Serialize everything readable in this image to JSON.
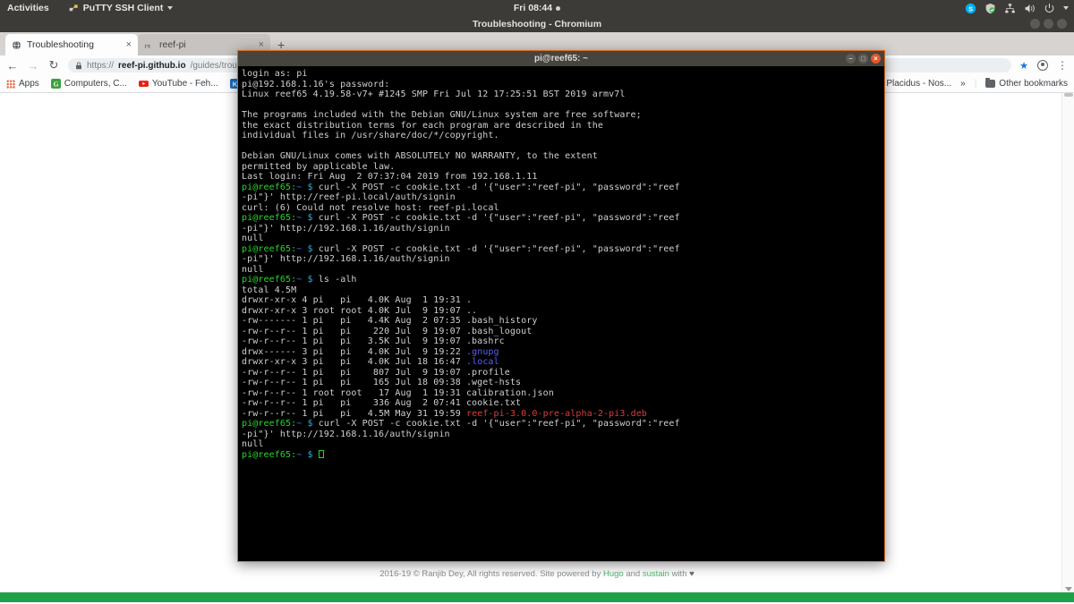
{
  "topbar": {
    "activities": "Activities",
    "app_menu": "PuTTY SSH Client",
    "clock": "Fri 08:44",
    "tray_icons": [
      "skype-icon",
      "shield-icon",
      "network-icon",
      "volume-icon",
      "power-icon",
      "caret-down-icon"
    ]
  },
  "browser": {
    "window_title": "Troubleshooting - Chromium",
    "tabs": [
      {
        "label": "Troubleshooting",
        "favicon": "globe-icon",
        "active": true,
        "close": "×"
      },
      {
        "label": "reef-pi",
        "favicon": "reef-pi-icon",
        "active": false,
        "close": "×"
      }
    ],
    "new_tab_label": "+",
    "nav": {
      "back": "←",
      "forward": "→",
      "reload": "↻"
    },
    "omnibox": {
      "lock": "🔒",
      "scheme": "https://",
      "domain": "reef-pi.github.io",
      "path": "/guides/troubleshoot",
      "full_url": "https://reef-pi.github.io/guides/troubleshoot"
    },
    "toolbar_right": {
      "star": "★",
      "profile": "avatar-icon",
      "menu": "⋮"
    },
    "bookmarks": [
      {
        "label": "Apps",
        "icon": "apps-grid-icon"
      },
      {
        "label": "Computers, C...",
        "icon": "green-g-icon",
        "color": "#3ba23b"
      },
      {
        "label": "YouTube - Feh...",
        "icon": "youtube-icon",
        "color": "#e62117"
      },
      {
        "label": "K",
        "icon": "k-icon",
        "color": "#1c6ec1"
      }
    ],
    "bookmarks_right": {
      "overflow_item": "Placidus - Nos...",
      "overflow_chevron": "»",
      "other_bookmarks": "Other bookmarks"
    }
  },
  "webpage": {
    "footer_prefix": "2016-19 © Ranjib Dey, All rights reserved. Site powered by ",
    "footer_link1": "Hugo",
    "footer_mid": " and ",
    "footer_link2": "sustain",
    "footer_suffix": " with ",
    "footer_heart": "♥"
  },
  "terminal": {
    "title": "pi@reef65: ~",
    "window_buttons": {
      "minimize": "–",
      "maximize": "□",
      "close": "×"
    },
    "prompt": {
      "user_host": "pi@reef65:",
      "tilde": "~",
      "dollar": "$"
    },
    "lines": [
      {
        "type": "plain",
        "text": "login as: pi"
      },
      {
        "type": "plain",
        "text": "pi@192.168.1.16's password:"
      },
      {
        "type": "plain",
        "text": "Linux reef65 4.19.58-v7+ #1245 SMP Fri Jul 12 17:25:51 BST 2019 armv7l"
      },
      {
        "type": "plain",
        "text": ""
      },
      {
        "type": "plain",
        "text": "The programs included with the Debian GNU/Linux system are free software;"
      },
      {
        "type": "plain",
        "text": "the exact distribution terms for each program are described in the"
      },
      {
        "type": "plain",
        "text": "individual files in /usr/share/doc/*/copyright."
      },
      {
        "type": "plain",
        "text": ""
      },
      {
        "type": "plain",
        "text": "Debian GNU/Linux comes with ABSOLUTELY NO WARRANTY, to the extent"
      },
      {
        "type": "plain",
        "text": "permitted by applicable law."
      },
      {
        "type": "plain",
        "text": "Last login: Fri Aug  2 07:37:04 2019 from 192.168.1.11"
      },
      {
        "type": "prompt",
        "text": " curl -X POST -c cookie.txt -d '{\"user\":\"reef-pi\", \"password\":\"reef"
      },
      {
        "type": "plain",
        "text": "-pi\"}' http://reef-pi.local/auth/signin"
      },
      {
        "type": "plain",
        "text": "curl: (6) Could not resolve host: reef-pi.local"
      },
      {
        "type": "prompt",
        "text": " curl -X POST -c cookie.txt -d '{\"user\":\"reef-pi\", \"password\":\"reef"
      },
      {
        "type": "plain",
        "text": "-pi\"}' http://192.168.1.16/auth/signin"
      },
      {
        "type": "plain",
        "text": "null"
      },
      {
        "type": "prompt",
        "text": " curl -X POST -c cookie.txt -d '{\"user\":\"reef-pi\", \"password\":\"reef"
      },
      {
        "type": "plain",
        "text": "-pi\"}' http://192.168.1.16/auth/signin"
      },
      {
        "type": "plain",
        "text": "null"
      },
      {
        "type": "prompt",
        "text": " ls -alh"
      },
      {
        "type": "plain",
        "text": "total 4.5M"
      },
      {
        "type": "plain",
        "text": "drwxr-xr-x 4 pi   pi   4.0K Aug  1 19:31 ."
      },
      {
        "type": "plain",
        "text": "drwxr-xr-x 3 root root 4.0K Jul  9 19:07 .."
      },
      {
        "type": "plain",
        "text": "-rw------- 1 pi   pi   4.4K Aug  2 07:35 .bash_history"
      },
      {
        "type": "plain",
        "text": "-rw-r--r-- 1 pi   pi    220 Jul  9 19:07 .bash_logout"
      },
      {
        "type": "plain",
        "text": "-rw-r--r-- 1 pi   pi   3.5K Jul  9 19:07 .bashrc"
      },
      {
        "type": "colored",
        "text": "drwx------ 3 pi   pi   4.0K Jul  9 19:22 ",
        "colored_text": ".gnupg",
        "color_class": "t-dir"
      },
      {
        "type": "colored",
        "text": "drwxr-xr-x 3 pi   pi   4.0K Jul 18 16:47 ",
        "colored_text": ".local",
        "color_class": "t-dir"
      },
      {
        "type": "plain",
        "text": "-rw-r--r-- 1 pi   pi    807 Jul  9 19:07 .profile"
      },
      {
        "type": "plain",
        "text": "-rw-r--r-- 1 pi   pi    165 Jul 18 09:38 .wget-hsts"
      },
      {
        "type": "plain",
        "text": "-rw-r--r-- 1 root root   17 Aug  1 19:31 calibration.json"
      },
      {
        "type": "plain",
        "text": "-rw-r--r-- 1 pi   pi    336 Aug  2 07:41 cookie.txt"
      },
      {
        "type": "colored",
        "text": "-rw-r--r-- 1 pi   pi   4.5M May 31 19:59 ",
        "colored_text": "reef-pi-3.0.0-pre-alpha-2-pi3.deb",
        "color_class": "t-archive"
      },
      {
        "type": "prompt",
        "text": " curl -X POST -c cookie.txt -d '{\"user\":\"reef-pi\", \"password\":\"reef"
      },
      {
        "type": "plain",
        "text": "-pi\"}' http://192.168.1.16/auth/signin"
      },
      {
        "type": "plain",
        "text": "null"
      },
      {
        "type": "prompt-cursor",
        "text": " "
      }
    ]
  }
}
